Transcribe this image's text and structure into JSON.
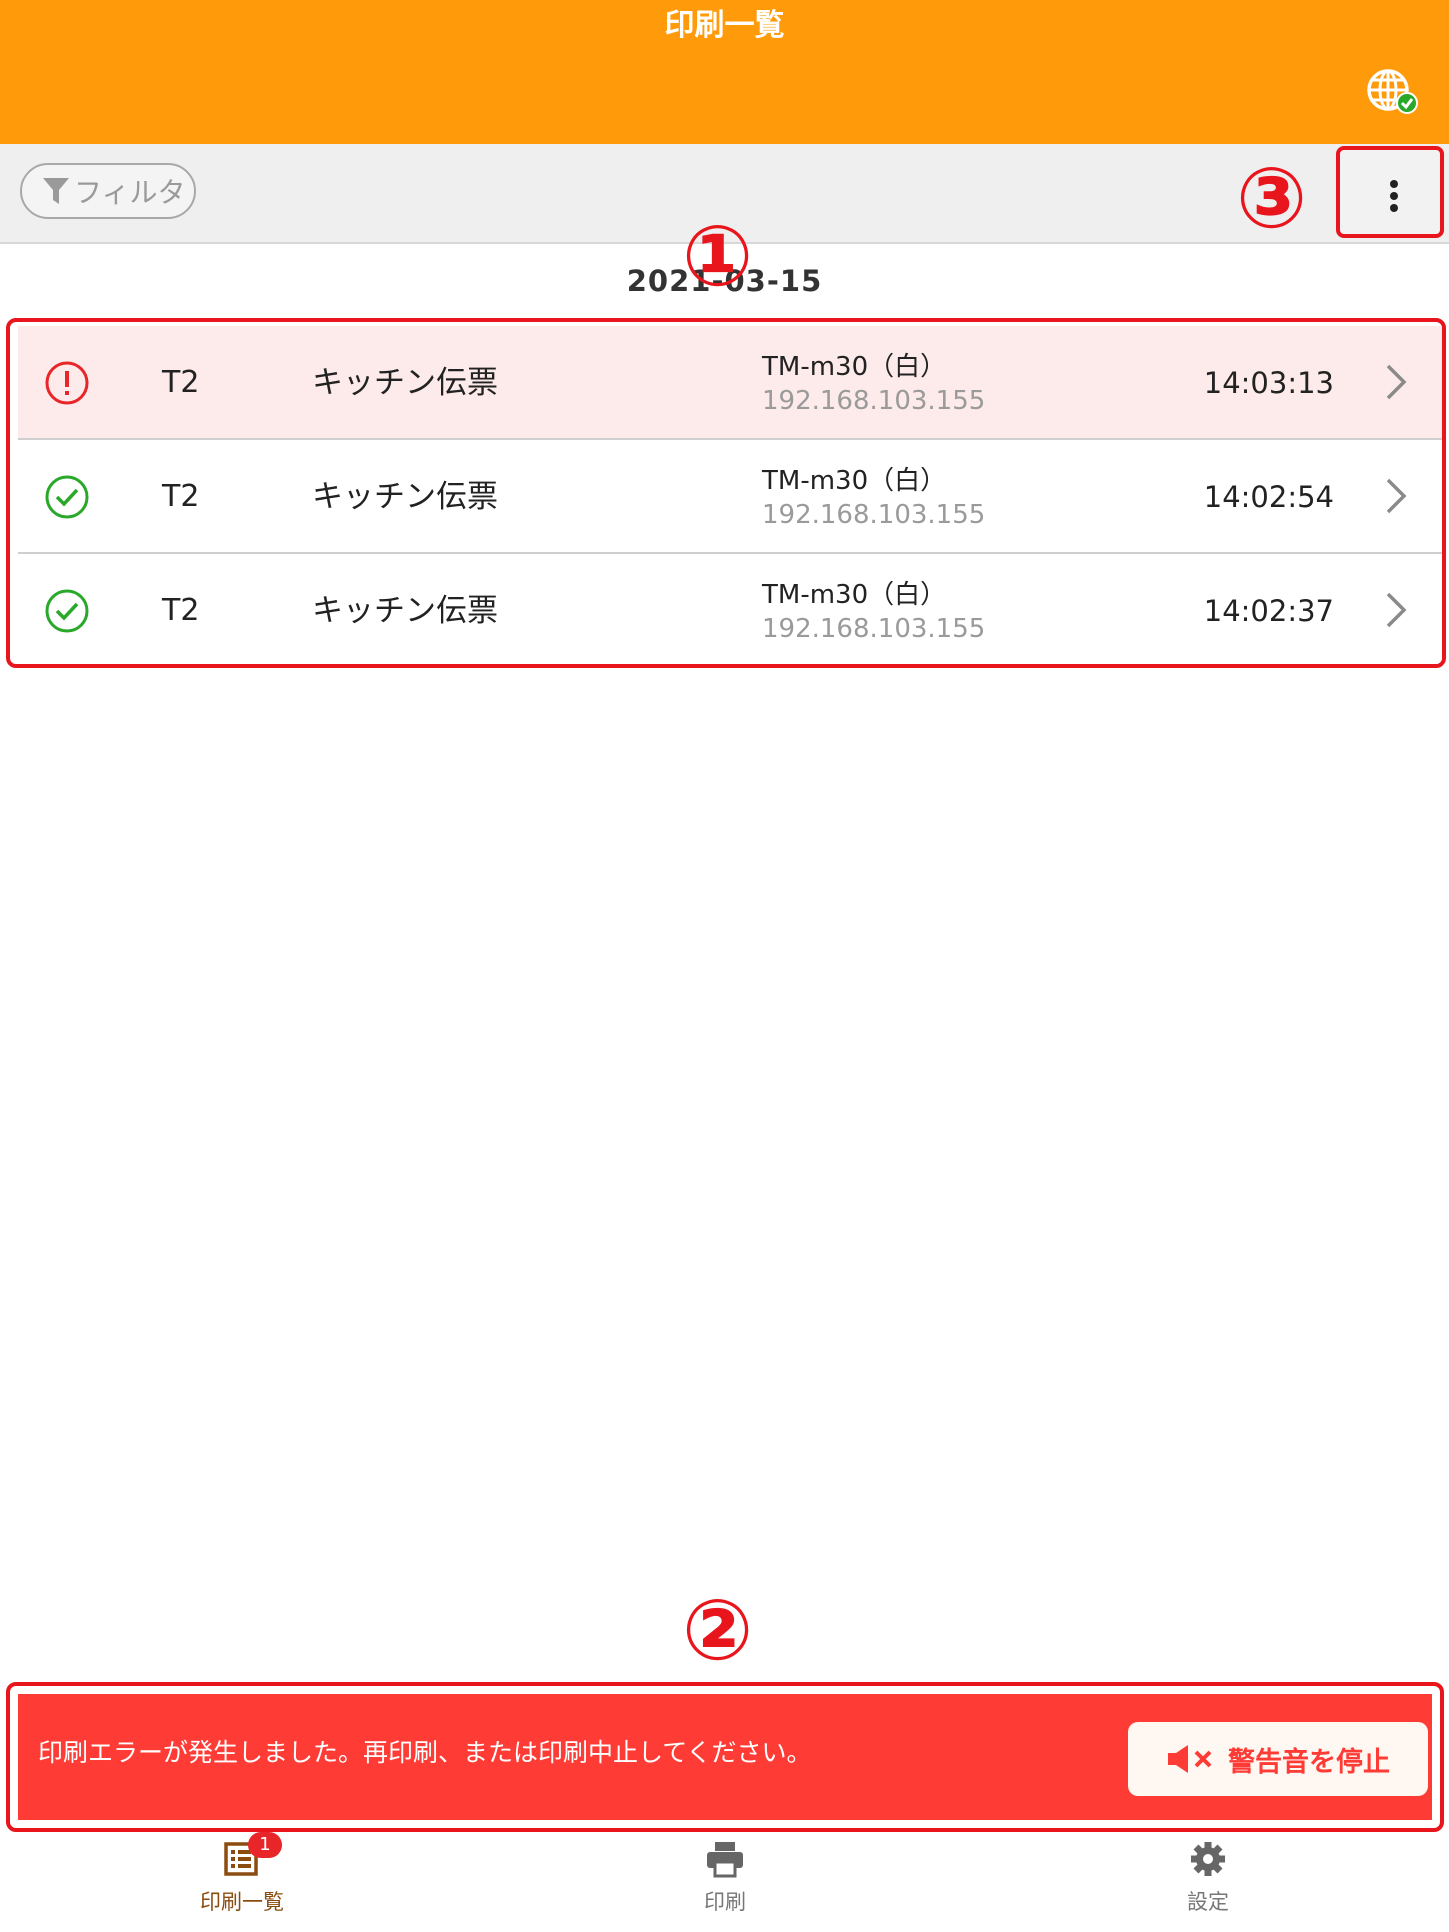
{
  "header": {
    "title": "印刷一覧",
    "globe_icon": "globe-connected-icon"
  },
  "toolbar": {
    "filter_label": "フィルタ"
  },
  "annotations": {
    "one": "①",
    "two": "②",
    "three": "③"
  },
  "date_label": "2021-03-15",
  "rows": [
    {
      "status": "error",
      "table": "T2",
      "document": "キッチン伝票",
      "printer": "TM-m30（白）",
      "ip": "192.168.103.155",
      "time": "14:03:13"
    },
    {
      "status": "success",
      "table": "T2",
      "document": "キッチン伝票",
      "printer": "TM-m30（白）",
      "ip": "192.168.103.155",
      "time": "14:02:54"
    },
    {
      "status": "success",
      "table": "T2",
      "document": "キッチン伝票",
      "printer": "TM-m30（白）",
      "ip": "192.168.103.155",
      "time": "14:02:37"
    }
  ],
  "error_banner": {
    "message": "印刷エラーが発生しました。再印刷、または印刷中止してください。",
    "stop_label": "警告音を停止"
  },
  "tabs": [
    {
      "label": "印刷一覧",
      "badge": "1",
      "icon": "list-icon",
      "active": true
    },
    {
      "label": "印刷",
      "icon": "printer-icon",
      "active": false
    },
    {
      "label": "設定",
      "icon": "gear-icon",
      "active": false
    }
  ],
  "colors": {
    "header": "#ff9a0b",
    "annotation_red": "#e8161c",
    "error_bg": "#ff3b35",
    "success": "#2aa82a"
  }
}
